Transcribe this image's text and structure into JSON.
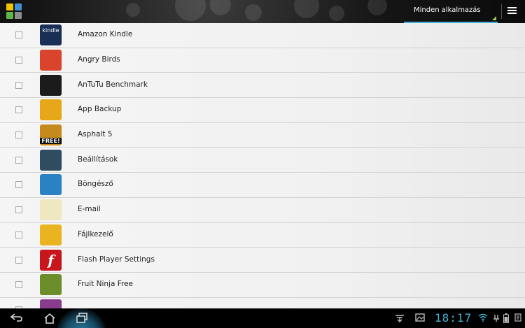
{
  "actionbar": {
    "spinner_label": "Minden alkalmazás"
  },
  "apps": [
    {
      "name": "Amazon Kindle",
      "icon": "kindle-icon",
      "icon_text": "kindle",
      "color": "#1a2f56"
    },
    {
      "name": "Angry Birds",
      "icon": "angry-birds-icon",
      "icon_text": "",
      "color": "#d9442c"
    },
    {
      "name": "AnTuTu Benchmark",
      "icon": "antutu-icon",
      "icon_text": "",
      "color": "#1b1b1b"
    },
    {
      "name": "App Backup",
      "icon": "app-backup-icon",
      "icon_text": "",
      "color": "#e6a718"
    },
    {
      "name": "Asphalt 5",
      "icon": "asphalt-icon",
      "icon_text": "FREE!",
      "color": "#c48a1c"
    },
    {
      "name": "Beállítások",
      "icon": "settings-icon",
      "icon_text": "",
      "color": "#2f4c60"
    },
    {
      "name": "Böngésző",
      "icon": "browser-globe-icon",
      "icon_text": "",
      "color": "#2a82c4"
    },
    {
      "name": "E-mail",
      "icon": "email-icon",
      "icon_text": "",
      "color": "#efe7bf"
    },
    {
      "name": "Fájlkezelő",
      "icon": "file-manager-icon",
      "icon_text": "",
      "color": "#e9b420"
    },
    {
      "name": "Flash Player Settings",
      "icon": "flash-icon",
      "icon_text": "f",
      "color": "#c8161d"
    },
    {
      "name": "Fruit Ninja Free",
      "icon": "fruit-ninja-icon",
      "icon_text": "",
      "color": "#6b8e2a"
    },
    {
      "name": "",
      "icon": "gallery-icon",
      "icon_text": "",
      "color": "#8a3c8c"
    }
  ],
  "status": {
    "time": "18:17"
  },
  "colors": {
    "accent": "#45b2d6"
  }
}
